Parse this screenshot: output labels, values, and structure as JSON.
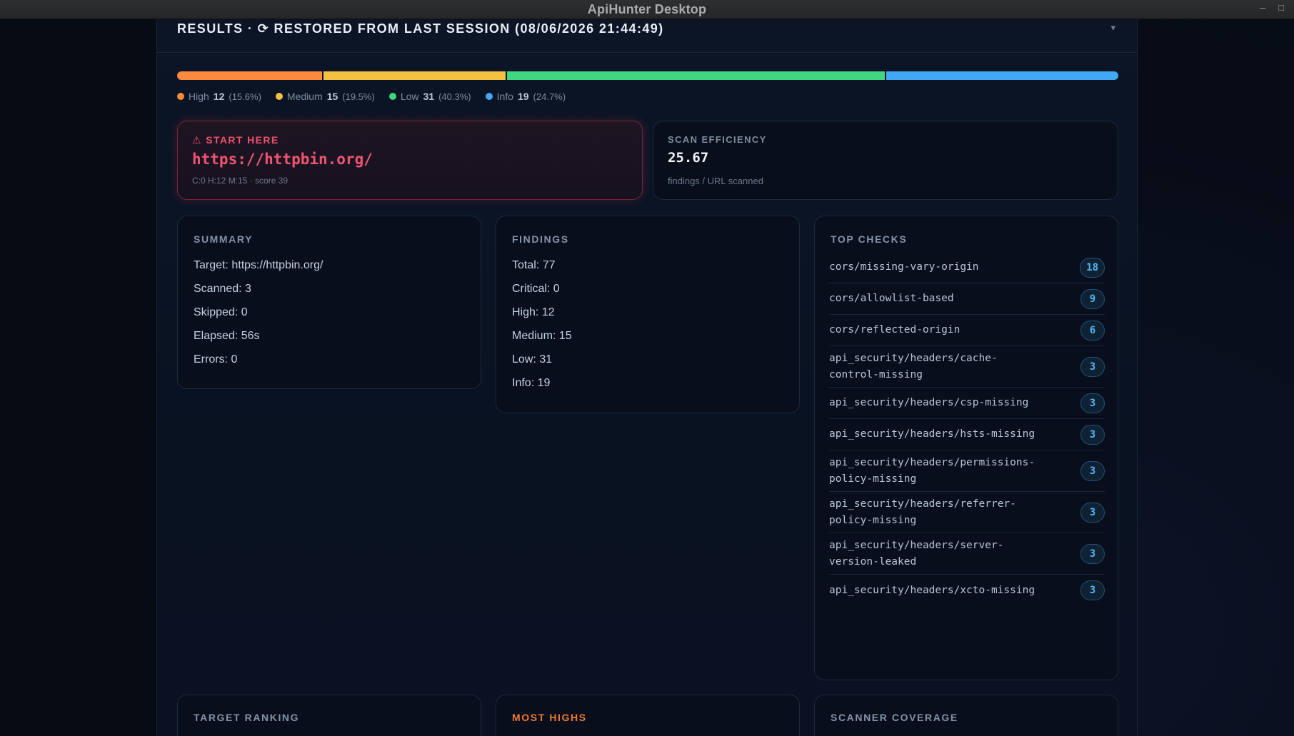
{
  "window": {
    "title": "ApiHunter Desktop",
    "minimize": "–",
    "maximize": "□"
  },
  "results": {
    "header": "RESULTS · ⟳ RESTORED FROM LAST SESSION (08/06/2026 21:44:49)",
    "collapse_icon": "▾"
  },
  "severity": {
    "segments": [
      {
        "name": "High",
        "count": "12",
        "pct": "(15.6%)",
        "fraction": 0.156,
        "color": "#fb8a3c"
      },
      {
        "name": "Medium",
        "count": "15",
        "pct": "(19.5%)",
        "fraction": 0.195,
        "color": "#f5c142"
      },
      {
        "name": "Low",
        "count": "31",
        "pct": "(40.3%)",
        "fraction": 0.403,
        "color": "#3ed67e"
      },
      {
        "name": "Info",
        "count": "19",
        "pct": "(24.7%)",
        "fraction": 0.247,
        "color": "#42a8f5"
      }
    ]
  },
  "start_here": {
    "label": "⚠ START HERE",
    "url": "https://httpbin.org/",
    "meta": "C:0 H:12 M:15 · score 39"
  },
  "efficiency": {
    "label": "SCAN EFFICIENCY",
    "value": "25.67",
    "sub": "findings / URL scanned"
  },
  "summary": {
    "label": "SUMMARY",
    "rows": [
      "Target: https://httpbin.org/",
      "Scanned: 3",
      "Skipped: 0",
      "Elapsed: 56s",
      "Errors: 0"
    ]
  },
  "findings": {
    "label": "FINDINGS",
    "rows": [
      "Total: 77",
      "Critical: 0",
      "High: 12",
      "Medium: 15",
      "Low: 31",
      "Info: 19"
    ]
  },
  "top_checks": {
    "label": "TOP CHECKS",
    "items": [
      {
        "name": "cors/missing-vary-origin",
        "count": "18"
      },
      {
        "name": "cors/allowlist-based",
        "count": "9"
      },
      {
        "name": "cors/reflected-origin",
        "count": "6"
      },
      {
        "name": "api_security/headers/cache-control-missing",
        "count": "3"
      },
      {
        "name": "api_security/headers/csp-missing",
        "count": "3"
      },
      {
        "name": "api_security/headers/hsts-missing",
        "count": "3"
      },
      {
        "name": "api_security/headers/permissions-policy-missing",
        "count": "3"
      },
      {
        "name": "api_security/headers/referrer-policy-missing",
        "count": "3"
      },
      {
        "name": "api_security/headers/server-version-leaked",
        "count": "3"
      },
      {
        "name": "api_security/headers/xcto-missing",
        "count": "3"
      }
    ]
  },
  "bottom": {
    "target_ranking": "TARGET RANKING",
    "most_highs": "MOST HIGHS",
    "scanner_coverage": "SCANNER COVERAGE"
  }
}
